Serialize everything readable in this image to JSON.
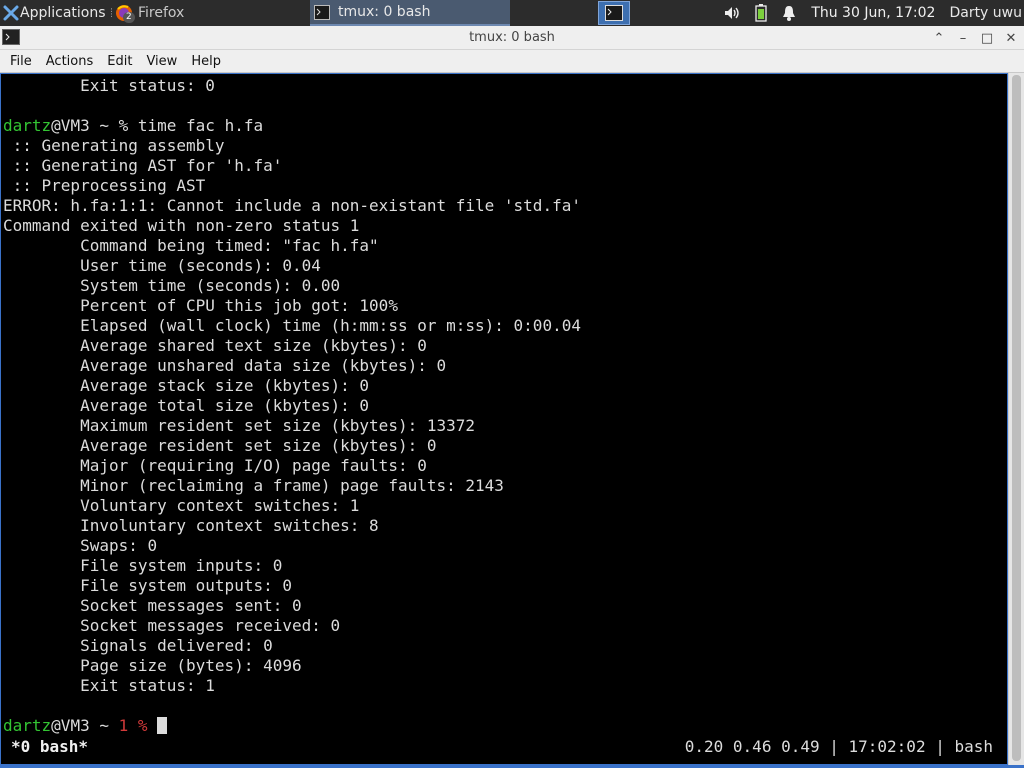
{
  "panel": {
    "apps_label": "Applications ≣",
    "firefox_label": "Firefox",
    "firefox_badge": "2",
    "tmux_task_label": "tmux: 0 bash",
    "clock": "Thu 30 Jun, 17:02",
    "user": "Darty uwu"
  },
  "window": {
    "title": "tmux: 0 bash",
    "buttons": {
      "shade": "⌃",
      "minimize": "–",
      "maximize": "□",
      "close": "✕"
    }
  },
  "menu": [
    "File",
    "Actions",
    "Edit",
    "View",
    "Help"
  ],
  "terminal": {
    "lines": [
      {
        "segs": [
          {
            "t": "        Exit status: 0"
          }
        ]
      },
      {
        "segs": [
          {
            "t": ""
          }
        ]
      },
      {
        "segs": [
          {
            "t": "dartz",
            "c": "green"
          },
          {
            "t": "@VM3 ~ % time fac h.fa"
          }
        ]
      },
      {
        "segs": [
          {
            "t": " :: Generating assembly"
          }
        ]
      },
      {
        "segs": [
          {
            "t": " :: Generating AST for 'h.fa'"
          }
        ]
      },
      {
        "segs": [
          {
            "t": " :: Preprocessing AST"
          }
        ]
      },
      {
        "segs": [
          {
            "t": "ERROR: h.fa:1:1: Cannot include a non-existant file 'std.fa'"
          }
        ]
      },
      {
        "segs": [
          {
            "t": "Command exited with non-zero status 1"
          }
        ]
      },
      {
        "segs": [
          {
            "t": "        Command being timed: \"fac h.fa\""
          }
        ]
      },
      {
        "segs": [
          {
            "t": "        User time (seconds): 0.04"
          }
        ]
      },
      {
        "segs": [
          {
            "t": "        System time (seconds): 0.00"
          }
        ]
      },
      {
        "segs": [
          {
            "t": "        Percent of CPU this job got: 100%"
          }
        ]
      },
      {
        "segs": [
          {
            "t": "        Elapsed (wall clock) time (h:mm:ss or m:ss): 0:00.04"
          }
        ]
      },
      {
        "segs": [
          {
            "t": "        Average shared text size (kbytes): 0"
          }
        ]
      },
      {
        "segs": [
          {
            "t": "        Average unshared data size (kbytes): 0"
          }
        ]
      },
      {
        "segs": [
          {
            "t": "        Average stack size (kbytes): 0"
          }
        ]
      },
      {
        "segs": [
          {
            "t": "        Average total size (kbytes): 0"
          }
        ]
      },
      {
        "segs": [
          {
            "t": "        Maximum resident set size (kbytes): 13372"
          }
        ]
      },
      {
        "segs": [
          {
            "t": "        Average resident set size (kbytes): 0"
          }
        ]
      },
      {
        "segs": [
          {
            "t": "        Major (requiring I/O) page faults: 0"
          }
        ]
      },
      {
        "segs": [
          {
            "t": "        Minor (reclaiming a frame) page faults: 2143"
          }
        ]
      },
      {
        "segs": [
          {
            "t": "        Voluntary context switches: 1"
          }
        ]
      },
      {
        "segs": [
          {
            "t": "        Involuntary context switches: 8"
          }
        ]
      },
      {
        "segs": [
          {
            "t": "        Swaps: 0"
          }
        ]
      },
      {
        "segs": [
          {
            "t": "        File system inputs: 0"
          }
        ]
      },
      {
        "segs": [
          {
            "t": "        File system outputs: 0"
          }
        ]
      },
      {
        "segs": [
          {
            "t": "        Socket messages sent: 0"
          }
        ]
      },
      {
        "segs": [
          {
            "t": "        Socket messages received: 0"
          }
        ]
      },
      {
        "segs": [
          {
            "t": "        Signals delivered: 0"
          }
        ]
      },
      {
        "segs": [
          {
            "t": "        Page size (bytes): 4096"
          }
        ]
      },
      {
        "segs": [
          {
            "t": "        Exit status: 1"
          }
        ]
      },
      {
        "segs": [
          {
            "t": ""
          }
        ]
      },
      {
        "segs": [
          {
            "t": "dartz",
            "c": "green"
          },
          {
            "t": "@VM3 ~ "
          },
          {
            "t": "1 %",
            "c": "red"
          },
          {
            "t": " "
          }
        ],
        "cursor": true
      }
    ],
    "status_left": "*0 bash*",
    "status_right": "0.20 0.46 0.49 | 17:02:02 | bash"
  },
  "colors": {
    "prompt_user": "#33c533",
    "exit_code": "#d23a3a",
    "window_border": "#3a72c9",
    "panel_bg": "#2c2c2c"
  },
  "icons": [
    "xfce-mouse-icon",
    "firefox-icon",
    "terminal-icon",
    "volume-icon",
    "battery-icon",
    "bell-icon"
  ]
}
